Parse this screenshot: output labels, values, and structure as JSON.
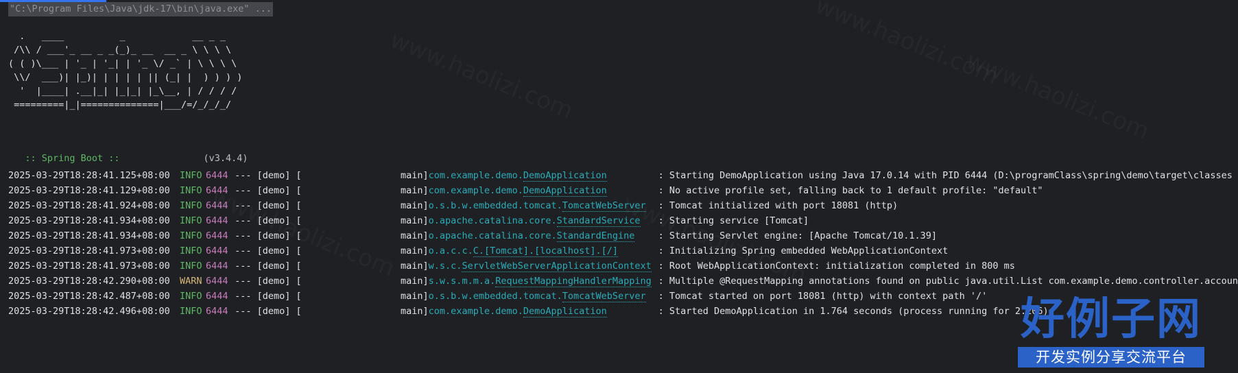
{
  "console": {
    "command": "\"C:\\Program Files\\Java\\jdk-17\\bin\\java.exe\" ...",
    "banner": "  .   ____          _            __ _ _\n /\\\\ / ___'_ __ _ _(_)_ __  __ _ \\ \\ \\ \\\n( ( )\\___ | '_ | '_| | '_ \\/ _` | \\ \\ \\ \\\n \\\\/  ___)| |_)| | | | | || (_| |  ) ) ) )\n  '  |____| .__|_| |_|_| |_\\__, | / / / /\n =========|_|==============|___/=/_/_/_/",
    "spring_label": " :: Spring Boot :: ",
    "spring_version": "              (v3.4.4)"
  },
  "log_rows": [
    {
      "timestamp": "2025-03-29T18:28:41.125+08:00",
      "level": "INFO",
      "pid": "6444",
      "sep": " --- [demo] [",
      "thread": "main]",
      "logger_pkg": "com.example.demo.",
      "logger_cls": "DemoApplication",
      "message": ": Starting DemoApplication using Java 17.0.14 with PID 6444 (D:\\programClass\\spring\\demo\\target\\classes started b"
    },
    {
      "timestamp": "2025-03-29T18:28:41.129+08:00",
      "level": "INFO",
      "pid": "6444",
      "sep": " --- [demo] [",
      "thread": "main]",
      "logger_pkg": "com.example.demo.",
      "logger_cls": "DemoApplication",
      "message": ": No active profile set, falling back to 1 default profile: \"default\""
    },
    {
      "timestamp": "2025-03-29T18:28:41.924+08:00",
      "level": "INFO",
      "pid": "6444",
      "sep": " --- [demo] [",
      "thread": "main]",
      "logger_pkg": "o.s.b.w.embedded.tomcat.",
      "logger_cls": "TomcatWebServer",
      "message": ": Tomcat initialized with port 18081 (http)"
    },
    {
      "timestamp": "2025-03-29T18:28:41.934+08:00",
      "level": "INFO",
      "pid": "6444",
      "sep": " --- [demo] [",
      "thread": "main]",
      "logger_pkg": "o.apache.catalina.core.",
      "logger_cls": "StandardService",
      "message": ": Starting service [Tomcat]"
    },
    {
      "timestamp": "2025-03-29T18:28:41.934+08:00",
      "level": "INFO",
      "pid": "6444",
      "sep": " --- [demo] [",
      "thread": "main]",
      "logger_pkg": "o.apache.catalina.core.",
      "logger_cls": "StandardEngine",
      "message": ": Starting Servlet engine: [Apache Tomcat/10.1.39]"
    },
    {
      "timestamp": "2025-03-29T18:28:41.973+08:00",
      "level": "INFO",
      "pid": "6444",
      "sep": " --- [demo] [",
      "thread": "main]",
      "logger_pkg": "o.a.c.c.",
      "logger_cls": "C.[Tomcat].[localhost].[/]",
      "message": ": Initializing Spring embedded WebApplicationContext"
    },
    {
      "timestamp": "2025-03-29T18:28:41.973+08:00",
      "level": "INFO",
      "pid": "6444",
      "sep": " --- [demo] [",
      "thread": "main]",
      "logger_pkg": "w.s.c.",
      "logger_cls": "ServletWebServerApplicationContext",
      "message": ": Root WebApplicationContext: initialization completed in 800 ms"
    },
    {
      "timestamp": "2025-03-29T18:28:42.290+08:00",
      "level": "WARN",
      "pid": "6444",
      "sep": " --- [demo] [",
      "thread": "main]",
      "logger_pkg": "s.w.s.m.m.a.",
      "logger_cls": "RequestMappingHandlerMapping",
      "message": ": Multiple @RequestMapping annotations found on public java.util.List com.example.demo.controller.accountControll"
    },
    {
      "timestamp": "2025-03-29T18:28:42.487+08:00",
      "level": "INFO",
      "pid": "6444",
      "sep": " --- [demo] [",
      "thread": "main]",
      "logger_pkg": "o.s.b.w.embedded.tomcat.",
      "logger_cls": "TomcatWebServer",
      "message": ": Tomcat started on port 18081 (http) with context path '/'"
    },
    {
      "timestamp": "2025-03-29T18:28:42.496+08:00",
      "level": "INFO",
      "pid": "6444",
      "sep": " --- [demo] [",
      "thread": "main]",
      "logger_pkg": "com.example.demo.",
      "logger_cls": "DemoApplication",
      "message": ": Started DemoApplication in 1.764 seconds (process running for 2.206)"
    }
  ],
  "watermark": {
    "logo_main": "好例子网",
    "logo_sub": "开发实例分享交流平台",
    "text": "www.haolizi.com"
  },
  "colors": {
    "background": "#1f2023",
    "info": "#5fb865",
    "warn": "#d5b778",
    "pid": "#c77dbb",
    "logger": "#2aacb8",
    "brand_blue": "#2a62c8"
  }
}
